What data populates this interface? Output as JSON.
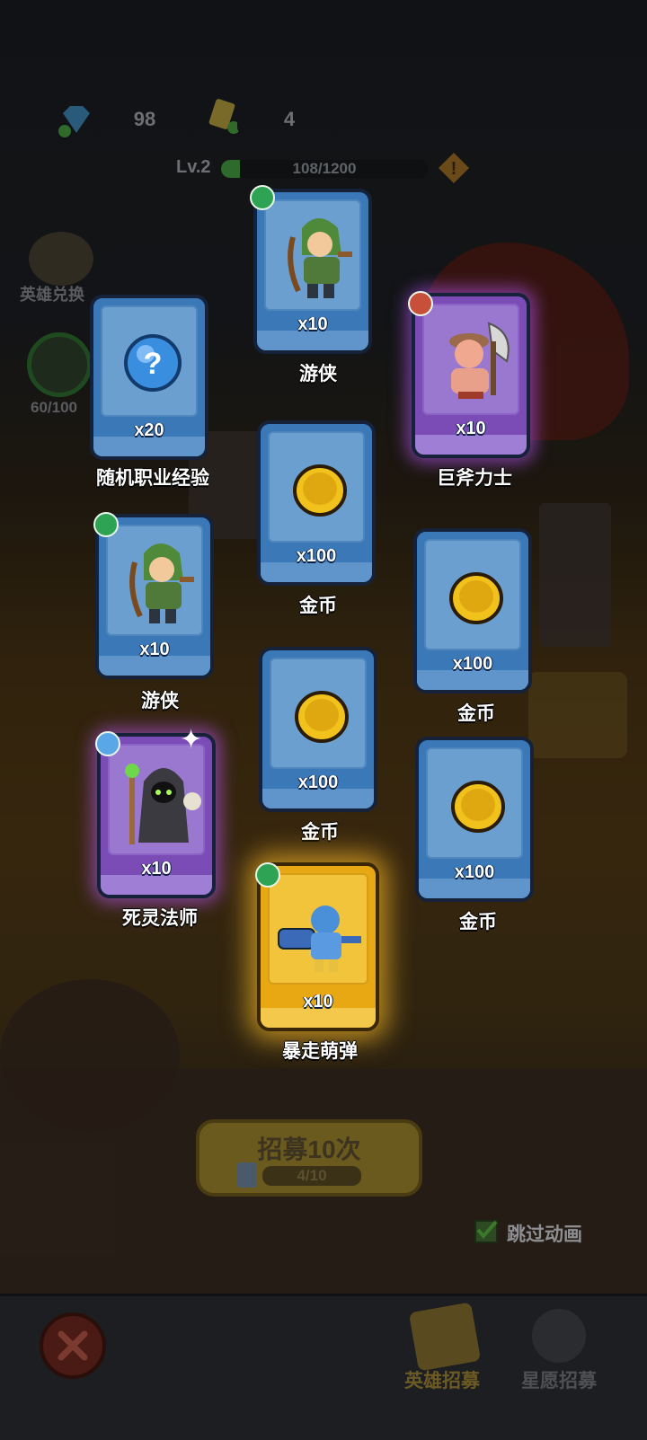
{
  "hud": {
    "gems": "98",
    "tickets": "4",
    "level": "Lv.2",
    "xp_text": "108/1200",
    "xp_fraction": 0.09
  },
  "side": {
    "hero_exchange": "英雄兑换",
    "progress": "60/100"
  },
  "cards": [
    {
      "id": "ranger-top",
      "qty": "x10",
      "name": "游侠",
      "rarity": "blue",
      "badge": "bow",
      "icon": "ranger-hero-icon"
    },
    {
      "id": "random-exp",
      "qty": "x20",
      "name": "随机职业经验",
      "rarity": "blue",
      "badge": "",
      "icon": "mystery-orb-icon"
    },
    {
      "id": "axe-warrior",
      "qty": "x10",
      "name": "巨斧力士",
      "rarity": "purple",
      "badge": "sword",
      "icon": "axe-warrior-hero-icon"
    },
    {
      "id": "gold-1",
      "qty": "x100",
      "name": "金币",
      "rarity": "blue",
      "badge": "",
      "icon": "gold-coin-icon"
    },
    {
      "id": "ranger-left",
      "qty": "x10",
      "name": "游侠",
      "rarity": "blue",
      "badge": "bow",
      "icon": "ranger-hero-icon"
    },
    {
      "id": "gold-2",
      "qty": "x100",
      "name": "金币",
      "rarity": "blue",
      "badge": "",
      "icon": "gold-coin-icon"
    },
    {
      "id": "gold-3",
      "qty": "x100",
      "name": "金币",
      "rarity": "blue",
      "badge": "",
      "icon": "gold-coin-icon"
    },
    {
      "id": "necromancer",
      "qty": "x10",
      "name": "死灵法师",
      "rarity": "purple",
      "badge": "swirl",
      "icon": "necromancer-hero-icon"
    },
    {
      "id": "gold-4",
      "qty": "x100",
      "name": "金币",
      "rarity": "blue",
      "badge": "",
      "icon": "gold-coin-icon"
    },
    {
      "id": "rampage-gunner",
      "qty": "x10",
      "name": "暴走萌弹",
      "rarity": "gold",
      "badge": "bow",
      "icon": "gunner-hero-icon"
    }
  ],
  "recruit": {
    "label": "招募10次",
    "progress": "4/10"
  },
  "skip_animation": "跳过动画",
  "nav": {
    "hero_recruit": "英雄招募",
    "star_recruit": "星愿招募"
  },
  "colors": {
    "card_blue": "#3a78b8",
    "card_purple": "#7b4bb6",
    "card_gold": "#e8a814",
    "coin": "#f2c21c"
  }
}
